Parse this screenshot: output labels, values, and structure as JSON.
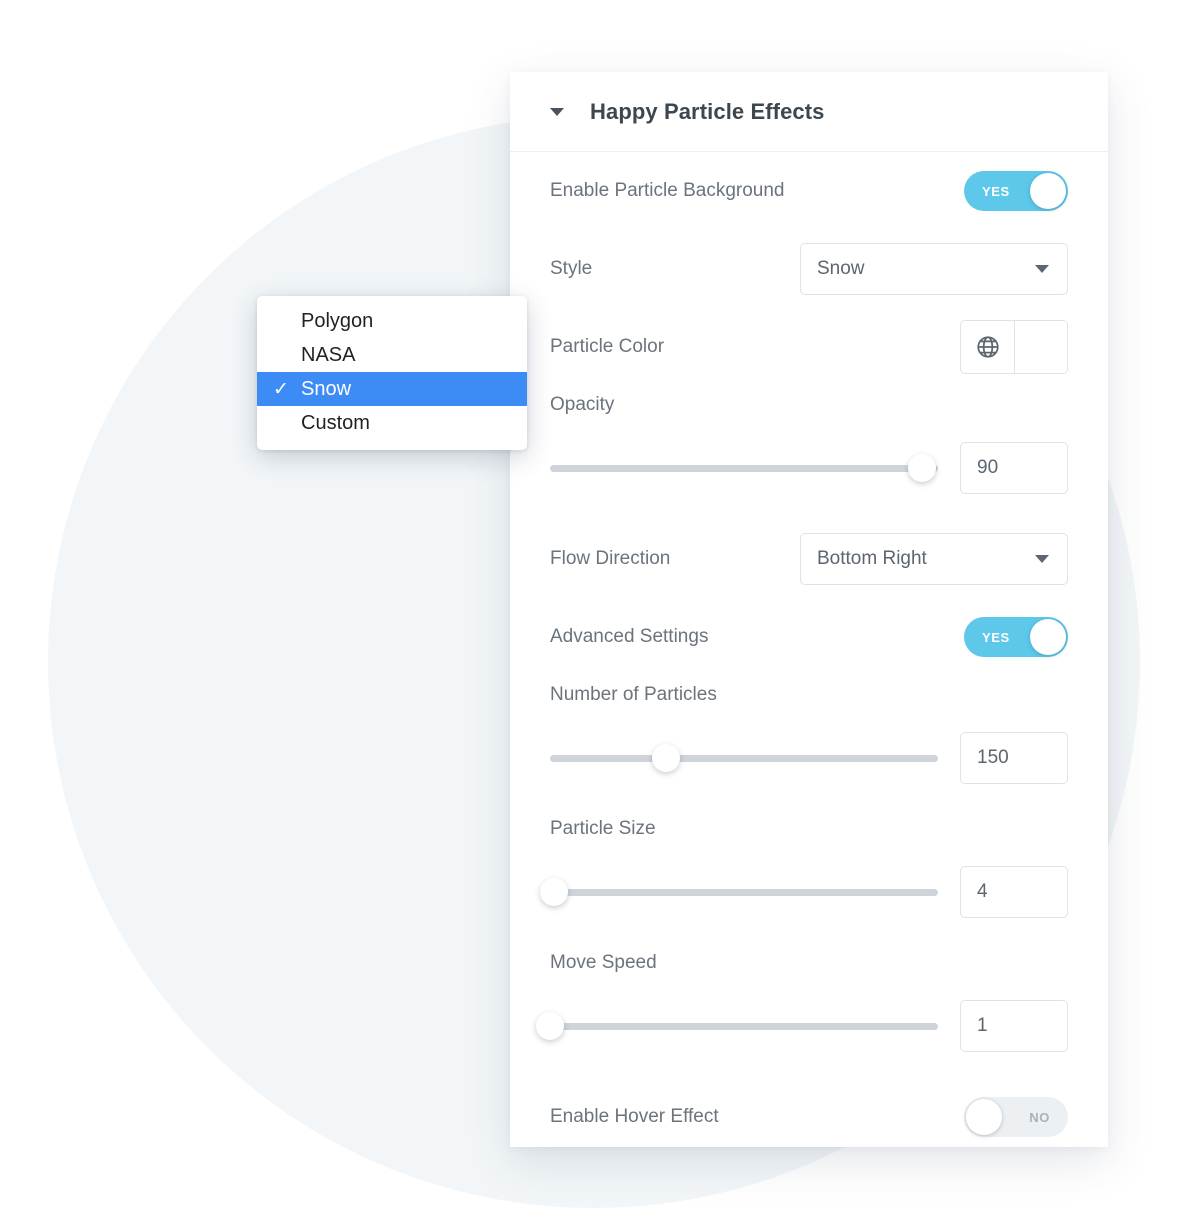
{
  "background": {
    "circle_color": "#eaf0f4",
    "page_color": "#ffffff"
  },
  "panel": {
    "header": {
      "caret_icon": "caret-down-icon",
      "title": "Happy Particle Effects"
    },
    "rows": {
      "enable_particle_background": {
        "label": "Enable Particle Background",
        "toggle_state": "on",
        "toggle_label": "YES"
      },
      "style": {
        "label": "Style",
        "value": "Snow",
        "caret_icon": "caret-down-icon"
      },
      "particle_color": {
        "label": "Particle Color",
        "globe_icon": "globe-icon",
        "swatch_color": "#ffffff"
      },
      "opacity": {
        "label": "Opacity",
        "value": "90",
        "slider_percent": 96
      },
      "flow_direction": {
        "label": "Flow Direction",
        "value": "Bottom Right",
        "caret_icon": "caret-down-icon"
      },
      "advanced_settings": {
        "label": "Advanced Settings",
        "toggle_state": "on",
        "toggle_label": "YES"
      },
      "number_of_particles": {
        "label": "Number of Particles",
        "value": "150",
        "slider_percent": 30
      },
      "particle_size": {
        "label": "Particle Size",
        "value": "4",
        "slider_percent": 1
      },
      "move_speed": {
        "label": "Move Speed",
        "value": "1",
        "slider_percent": 0
      },
      "enable_hover_effect": {
        "label": "Enable Hover Effect",
        "toggle_state": "off",
        "toggle_label": "NO"
      }
    }
  },
  "dropdown": {
    "accent_color": "#3d8bf5",
    "selected_value": "Snow",
    "items": [
      {
        "label": "Polygon",
        "selected": false,
        "check": ""
      },
      {
        "label": "NASA",
        "selected": false,
        "check": ""
      },
      {
        "label": "Snow",
        "selected": true,
        "check": "✓"
      },
      {
        "label": "Custom",
        "selected": false,
        "check": ""
      }
    ]
  }
}
